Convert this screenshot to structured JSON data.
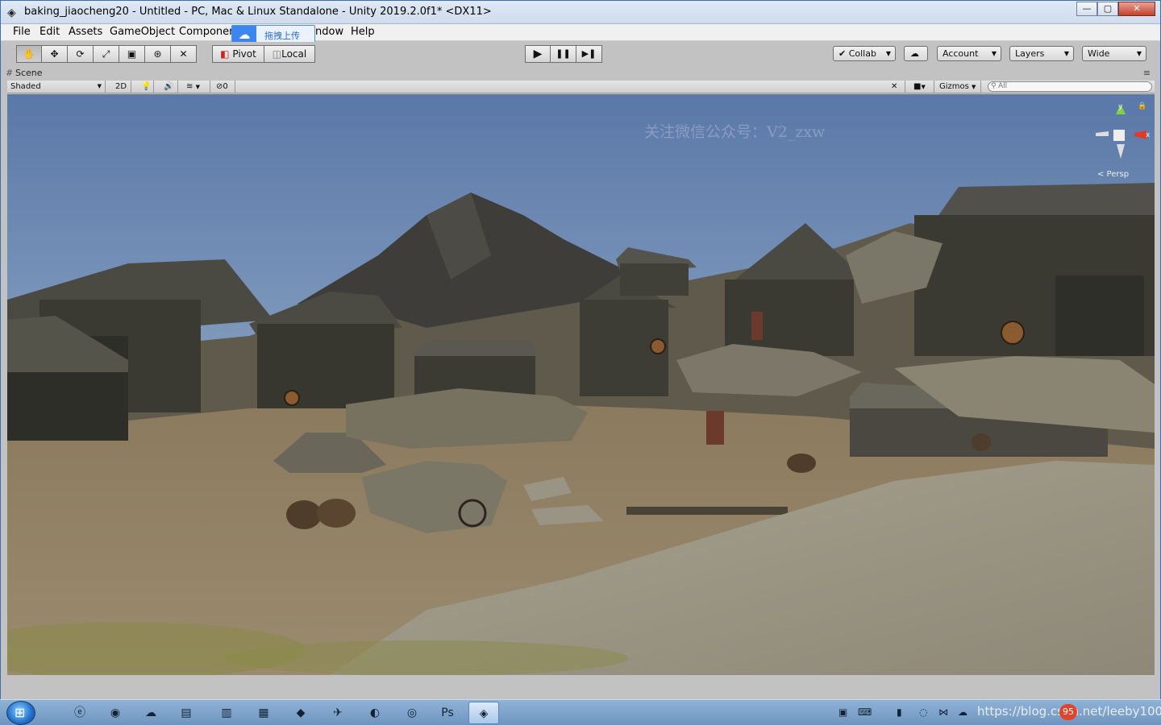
{
  "window": {
    "title": "baking_jiaocheng20 - Untitled - PC, Mac & Linux Standalone - Unity 2019.2.0f1* <DX11>",
    "icon": "unity-icon",
    "controls": {
      "minimize": "—",
      "maximize": "▢",
      "close": "✕"
    }
  },
  "menu": {
    "items": [
      "File",
      "Edit",
      "Assets",
      "GameObject",
      "Componen",
      "ndow",
      "Help"
    ],
    "upload_popup": "拖拽上传"
  },
  "toolbar": {
    "tools": [
      "hand-icon",
      "move-icon",
      "rotate-icon",
      "scale-icon",
      "rect-icon",
      "transform-icon",
      "custom-tool-icon"
    ],
    "pivot_label": "Pivot",
    "local_label": "Local",
    "play": "▶",
    "pause": "❚❚",
    "step": "▶❚",
    "collab_label": "Collab",
    "account_label": "Account",
    "layers_label": "Layers",
    "layout_label": "Wide"
  },
  "scene": {
    "tab_label": "Scene",
    "shading_mode": "Shaded",
    "mode_2d": "2D",
    "effects_count": "0",
    "gizmos_label": "Gizmos",
    "search_placeholder": "All",
    "projection_label": "< Persp",
    "watermark": "关注微信公众号：V2_zxw"
  },
  "taskbar": {
    "start": "⊞",
    "apps": [
      "ie-icon",
      "chrome-icon",
      "baidu-netdisk-icon",
      "explorer-icon",
      "media-icon",
      "wechat-icon",
      "app-icon",
      "feishu-icon",
      "app2-icon",
      "app3-icon",
      "photoshop-icon",
      "unity-icon"
    ],
    "tray_url": "https://blog.csdn.net/leeby100",
    "notification_badge": "95"
  },
  "colors": {
    "sky_top": "#5a78a8",
    "sky_bottom": "#a9bfd6",
    "ground": "#8b7a5e",
    "unity_gray": "#c2c2c2"
  }
}
